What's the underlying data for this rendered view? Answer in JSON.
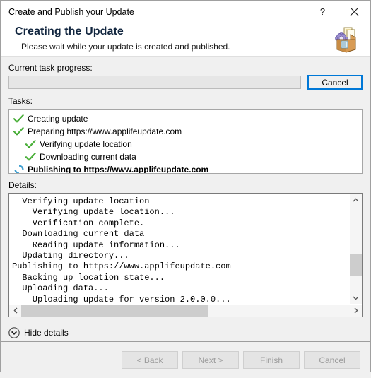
{
  "window": {
    "title": "Create and Publish your Update",
    "help_label": "?",
    "close_label": "close-icon"
  },
  "header": {
    "heading": "Creating the Update",
    "subtitle": "Please wait while your update is created and published.",
    "icon": "package-box-gear-icon"
  },
  "progress": {
    "label": "Current task progress:",
    "value_percent": 0,
    "cancel_label": "Cancel"
  },
  "tasks": {
    "label": "Tasks:",
    "items": [
      {
        "text": "Creating update",
        "status": "done",
        "indent": 0,
        "active": false
      },
      {
        "text": "Preparing https://www.applifeupdate.com",
        "status": "done",
        "indent": 0,
        "active": false
      },
      {
        "text": "Verifying update location",
        "status": "done",
        "indent": 1,
        "active": false
      },
      {
        "text": "Downloading current data",
        "status": "done",
        "indent": 1,
        "active": false
      },
      {
        "text": "Publishing to https://www.applifeupdate.com",
        "status": "running",
        "indent": 0,
        "active": true
      }
    ]
  },
  "details": {
    "label": "Details:",
    "lines": [
      "  Verifying update location",
      "    Verifying update location...",
      "    Verification complete.",
      "  Downloading current data",
      "    Reading update information...",
      "  Updating directory...",
      "Publishing to https://www.applifeupdate.com",
      "  Backing up location state...",
      "  Uploading data...",
      "    Uploading update for version 2.0.0.0..."
    ],
    "scroll_up_icon": "chevron-up-icon",
    "scroll_down_icon": "chevron-down-icon",
    "scroll_left_icon": "chevron-left-icon",
    "scroll_right_icon": "chevron-right-icon"
  },
  "expander": {
    "label": "Hide details",
    "icon": "chevron-down-circle-icon"
  },
  "footer": {
    "buttons": [
      {
        "label": "< Back",
        "enabled": false
      },
      {
        "label": "Next >",
        "enabled": false
      },
      {
        "label": "Finish",
        "enabled": false
      },
      {
        "label": "Cancel",
        "enabled": false
      }
    ]
  },
  "colors": {
    "accent": "#0078d7",
    "check_green": "#3aa02c",
    "spinner_blue": "#3f9fd0",
    "heading": "#12263f",
    "dialog_bg": "#f0f0f0"
  }
}
